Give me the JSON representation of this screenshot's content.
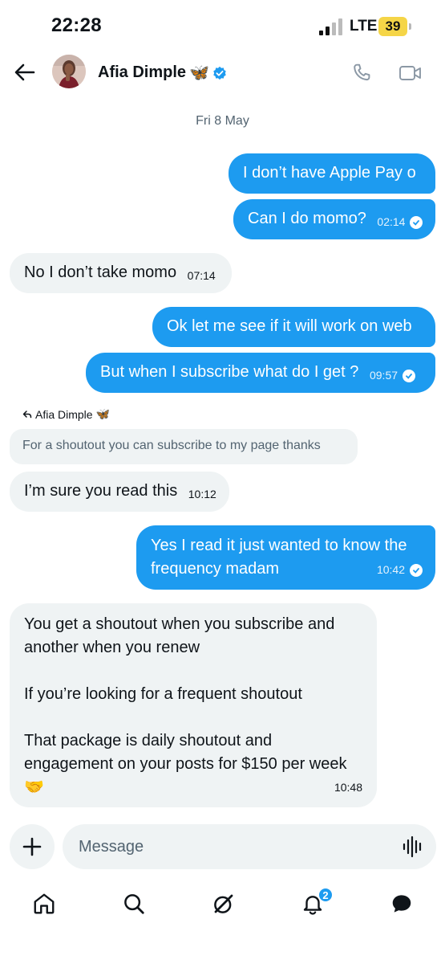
{
  "status_bar": {
    "time": "22:28",
    "network": "LTE",
    "battery": "39"
  },
  "header": {
    "contact_name": "Afia Dimple",
    "contact_emoji": "🦋"
  },
  "date_separator": "Fri 8 May",
  "messages": [
    {
      "text": "I don’t have Apple Pay o",
      "time": ""
    },
    {
      "text": "Can I do momo?",
      "time": "02:14"
    },
    {
      "text": "No I don’t take momo",
      "time": "07:14"
    },
    {
      "text": "Ok let me see if it will work on web",
      "time": ""
    },
    {
      "text": "But when I subscribe what do I get ?",
      "time": "09:57"
    },
    {
      "text": "I’m sure you read this",
      "time": "10:12"
    },
    {
      "text": "Yes I read it just wanted to know the frequency madam",
      "time": "10:42"
    },
    {
      "lines": [
        "You get a shoutout when you subscribe and",
        "another when you renew",
        "If you’re looking for a frequent shoutout",
        "That package is daily shoutout and",
        "engagement on your posts for $150 per week",
        "🤝"
      ],
      "time": "10:48"
    }
  ],
  "reply": {
    "author": "Afia Dimple",
    "author_emoji": "🦋",
    "quoted_text": "For a shoutout you can subscribe to my page thanks"
  },
  "composer": {
    "placeholder": "Message"
  },
  "tabs": {
    "items": [
      "home-icon",
      "search-icon",
      "grok-icon",
      "bell-icon",
      "messages-icon"
    ],
    "notification_count": "2"
  },
  "colors": {
    "accent": "#1d9bf0",
    "incoming_bubble": "#eff3f4",
    "text": "#0f1419",
    "muted": "#536471"
  }
}
